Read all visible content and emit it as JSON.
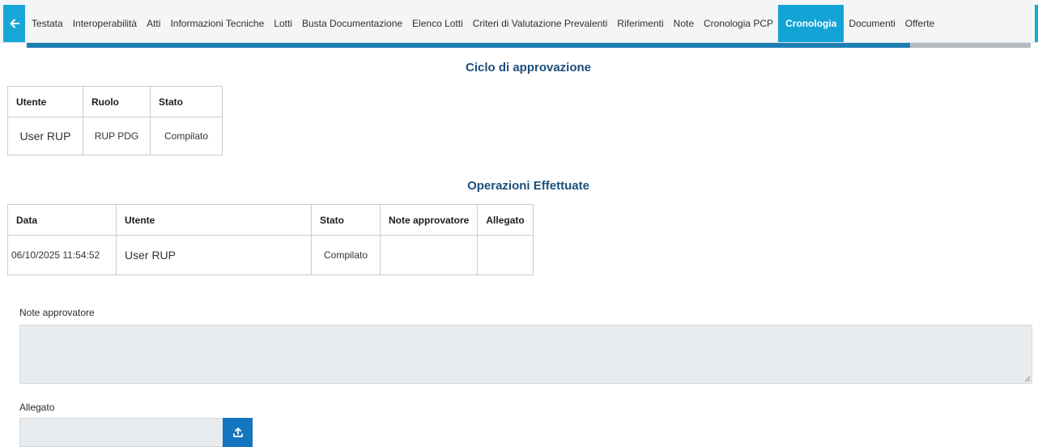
{
  "tabs": [
    {
      "label": "Testata",
      "active": false
    },
    {
      "label": "Interoperabilità",
      "active": false
    },
    {
      "label": "Atti",
      "active": false
    },
    {
      "label": "Informazioni Tecniche",
      "active": false
    },
    {
      "label": "Lotti",
      "active": false
    },
    {
      "label": "Busta Documentazione",
      "active": false
    },
    {
      "label": "Elenco Lotti",
      "active": false
    },
    {
      "label": "Criteri di Valutazione Prevalenti",
      "active": false
    },
    {
      "label": "Riferimenti",
      "active": false
    },
    {
      "label": "Note",
      "active": false
    },
    {
      "label": "Cronologia PCP",
      "active": false
    },
    {
      "label": "Cronologia",
      "active": true
    },
    {
      "label": "Documenti",
      "active": false
    },
    {
      "label": "Offerte",
      "active": false
    }
  ],
  "tab_progress": 0.88,
  "colors": {
    "accent": "#13a3d4",
    "title": "#1b4e7a",
    "progress": "#1b7fb4",
    "upload": "#1576c0"
  },
  "approval": {
    "title": "Ciclo di approvazione",
    "headers": {
      "utente": "Utente",
      "ruolo": "Ruolo",
      "stato": "Stato"
    },
    "row": {
      "utente": "User RUP",
      "ruolo": "RUP PDG",
      "stato": "Compilato"
    }
  },
  "operations": {
    "title": "Operazioni Effettuate",
    "headers": {
      "data": "Data",
      "utente": "Utente",
      "stato": "Stato",
      "note": "Note approvatore",
      "allegato": "Allegato"
    },
    "row": {
      "data": "06/10/2025 11:54:52",
      "utente": "User RUP",
      "stato": "Compilato",
      "note": "",
      "allegato": ""
    }
  },
  "form": {
    "note_label": "Note approvatore",
    "note_value": "",
    "allegato_label": "Allegato",
    "allegato_value": ""
  },
  "icons": {
    "back": "arrow-left-icon",
    "upload": "upload-icon",
    "resize": "resize-handle-icon"
  }
}
